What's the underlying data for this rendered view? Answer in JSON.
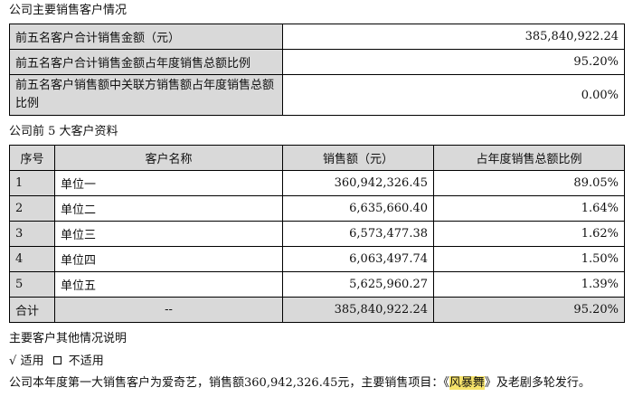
{
  "section1_title": "公司主要销售客户情况",
  "summary": [
    {
      "label": "前五名客户合计销售金额（元）",
      "value": "385,840,922.24"
    },
    {
      "label": "前五名客户合计销售金额占年度销售总额比例",
      "value": "95.20%"
    },
    {
      "label": "前五名客户销售额中关联方销售额占年度销售总额比例",
      "value": "0.00%"
    }
  ],
  "section2_title": "公司前 5 大客户资料",
  "table": {
    "headers": [
      "序号",
      "客户名称",
      "销售额（元）",
      "占年度销售总额比例"
    ],
    "rows": [
      [
        "1",
        "单位一",
        "360,942,326.45",
        "89.05%"
      ],
      [
        "2",
        "单位二",
        "6,635,660.40",
        "1.64%"
      ],
      [
        "3",
        "单位三",
        "6,573,477.38",
        "1.62%"
      ],
      [
        "4",
        "单位四",
        "6,063,497.74",
        "1.50%"
      ],
      [
        "5",
        "单位五",
        "5,625,960.27",
        "1.39%"
      ]
    ],
    "total": [
      "合计",
      "--",
      "385,840,922.24",
      "95.20%"
    ]
  },
  "section3_title": "主要客户其他情况说明",
  "applicable": {
    "check": "√",
    "yes": "适用",
    "no": "不适用"
  },
  "note": {
    "before": "公司本年度第一大销售客户为爱奇艺，销售额360,942,326.45元，主要销售项目：《",
    "highlight": "风暴舞",
    "after": "》及老剧多轮发行。"
  }
}
